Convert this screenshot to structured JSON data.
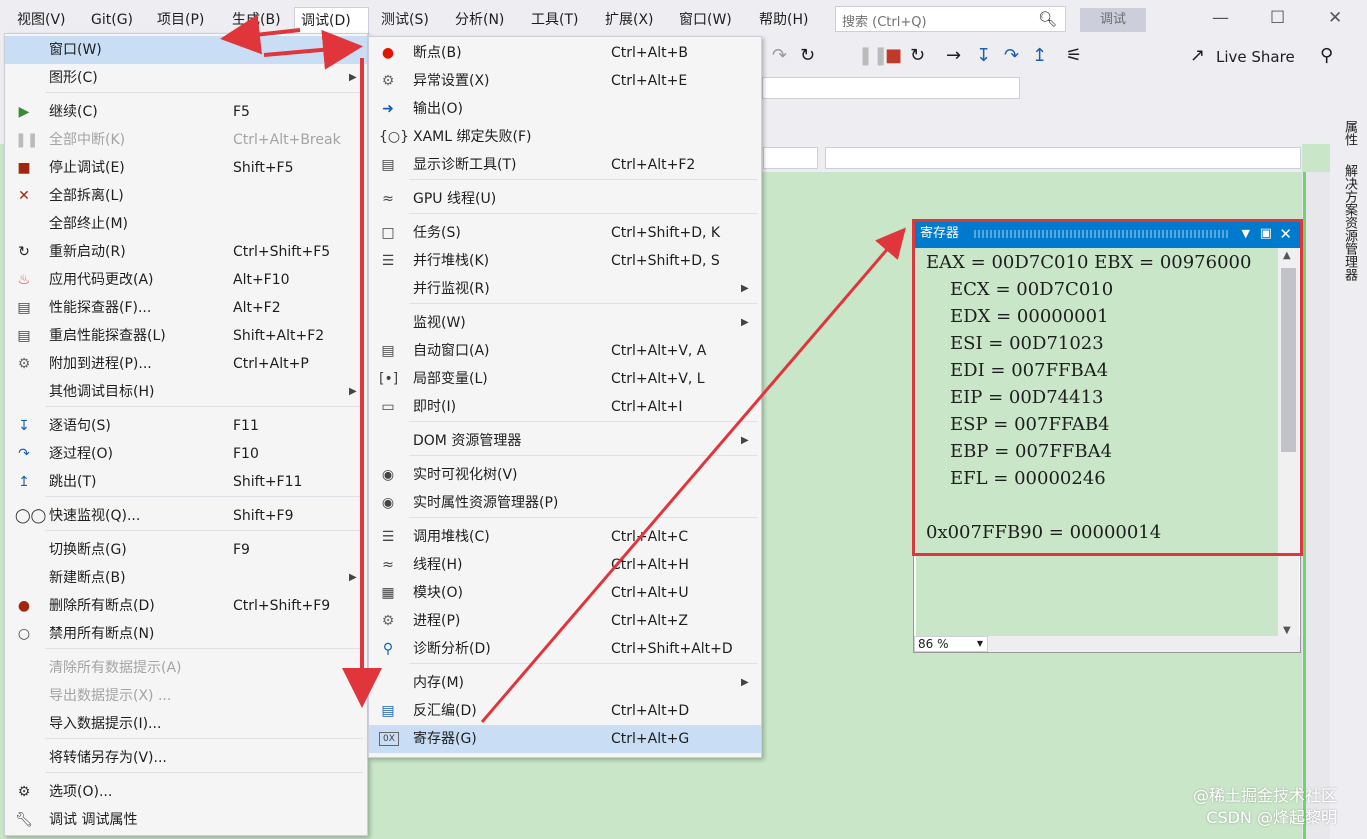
{
  "menubar": {
    "items": [
      "视图(V)",
      "Git(G)",
      "项目(P)",
      "生成(B)",
      "调试(D)",
      "测试(S)",
      "分析(N)",
      "工具(T)",
      "扩展(X)",
      "窗口(W)",
      "帮助(H)"
    ],
    "search_placeholder": "搜索 (Ctrl+Q)",
    "debug_badge": "调试"
  },
  "toolbar": {
    "live_share": "Live Share"
  },
  "side_tabs": [
    "属性",
    "解决方案资源管理器"
  ],
  "debug_menu": [
    {
      "label": "窗口(W)",
      "shortcut": "",
      "icon": "",
      "submenu": true,
      "highlighted": true
    },
    {
      "label": "图形(C)",
      "shortcut": "",
      "icon": "",
      "submenu": true
    },
    {
      "label": "继续(C)",
      "shortcut": "F5",
      "icon": "play-icon"
    },
    {
      "label": "全部中断(K)",
      "shortcut": "Ctrl+Alt+Break",
      "icon": "pause-icon",
      "disabled": true
    },
    {
      "label": "停止调试(E)",
      "shortcut": "Shift+F5",
      "icon": "stop-icon"
    },
    {
      "label": "全部拆离(L)",
      "shortcut": "",
      "icon": "close-icon"
    },
    {
      "label": "全部终止(M)",
      "shortcut": "",
      "icon": ""
    },
    {
      "label": "重新启动(R)",
      "shortcut": "Ctrl+Shift+F5",
      "icon": "restart-icon"
    },
    {
      "label": "应用代码更改(A)",
      "shortcut": "Alt+F10",
      "icon": "flame-icon"
    },
    {
      "label": "性能探查器(F)...",
      "shortcut": "Alt+F2",
      "icon": "chart-icon"
    },
    {
      "label": "重启性能探查器(L)",
      "shortcut": "Shift+Alt+F2",
      "icon": "chart-icon"
    },
    {
      "label": "附加到进程(P)...",
      "shortcut": "Ctrl+Alt+P",
      "icon": "gears-icon"
    },
    {
      "label": "其他调试目标(H)",
      "shortcut": "",
      "icon": "",
      "submenu": true
    },
    {
      "label": "逐语句(S)",
      "shortcut": "F11",
      "icon": "step-into-icon"
    },
    {
      "label": "逐过程(O)",
      "shortcut": "F10",
      "icon": "step-over-icon"
    },
    {
      "label": "跳出(T)",
      "shortcut": "Shift+F11",
      "icon": "step-out-icon"
    },
    {
      "label": "快速监视(Q)...",
      "shortcut": "Shift+F9",
      "icon": "glasses-icon"
    },
    {
      "label": "切换断点(G)",
      "shortcut": "F9",
      "icon": ""
    },
    {
      "label": "新建断点(B)",
      "shortcut": "",
      "icon": "",
      "submenu": true
    },
    {
      "label": "删除所有断点(D)",
      "shortcut": "Ctrl+Shift+F9",
      "icon": "breakpoints-delete-icon"
    },
    {
      "label": "禁用所有断点(N)",
      "shortcut": "",
      "icon": "breakpoints-disable-icon"
    },
    {
      "label": "清除所有数据提示(A)",
      "shortcut": "",
      "icon": "",
      "disabled": true
    },
    {
      "label": "导出数据提示(X) ...",
      "shortcut": "",
      "icon": "",
      "disabled": true
    },
    {
      "label": "导入数据提示(I)...",
      "shortcut": "",
      "icon": ""
    },
    {
      "label": "将转储另存为(V)...",
      "shortcut": "",
      "icon": ""
    },
    {
      "label": "选项(O)...",
      "shortcut": "",
      "icon": "gear-icon"
    },
    {
      "label": "调试 调试属性",
      "shortcut": "",
      "icon": "wrench-icon"
    }
  ],
  "window_menu": [
    {
      "label": "断点(B)",
      "shortcut": "Ctrl+Alt+B",
      "icon": "breakpoint-icon"
    },
    {
      "label": "异常设置(X)",
      "shortcut": "Ctrl+Alt+E",
      "icon": "exception-icon"
    },
    {
      "label": "输出(O)",
      "shortcut": "",
      "icon": "output-icon"
    },
    {
      "label": "XAML 绑定失败(F)",
      "shortcut": "",
      "icon": "xaml-icon"
    },
    {
      "label": "显示诊断工具(T)",
      "shortcut": "Ctrl+Alt+F2",
      "icon": "diagnostics-icon"
    },
    {
      "label": "GPU 线程(U)",
      "shortcut": "",
      "icon": "gpu-thread-icon"
    },
    {
      "label": "任务(S)",
      "shortcut": "Ctrl+Shift+D, K",
      "icon": "task-icon"
    },
    {
      "label": "并行堆栈(K)",
      "shortcut": "Ctrl+Shift+D, S",
      "icon": "parallel-stack-icon"
    },
    {
      "label": "并行监视(R)",
      "shortcut": "",
      "icon": "",
      "submenu": true
    },
    {
      "label": "监视(W)",
      "shortcut": "",
      "icon": "",
      "submenu": true
    },
    {
      "label": "自动窗口(A)",
      "shortcut": "Ctrl+Alt+V, A",
      "icon": "autos-icon"
    },
    {
      "label": "局部变量(L)",
      "shortcut": "Ctrl+Alt+V, L",
      "icon": "locals-icon"
    },
    {
      "label": "即时(I)",
      "shortcut": "Ctrl+Alt+I",
      "icon": "immediate-icon"
    },
    {
      "label": "DOM 资源管理器",
      "shortcut": "",
      "icon": "",
      "submenu": true
    },
    {
      "label": "实时可视化树(V)",
      "shortcut": "",
      "icon": "camera-icon"
    },
    {
      "label": "实时属性资源管理器(P)",
      "shortcut": "",
      "icon": "camera-icon"
    },
    {
      "label": "调用堆栈(C)",
      "shortcut": "Ctrl+Alt+C",
      "icon": "call-stack-icon"
    },
    {
      "label": "线程(H)",
      "shortcut": "Ctrl+Alt+H",
      "icon": "threads-icon"
    },
    {
      "label": "模块(O)",
      "shortcut": "Ctrl+Alt+U",
      "icon": "modules-icon"
    },
    {
      "label": "进程(P)",
      "shortcut": "Ctrl+Alt+Z",
      "icon": "processes-icon"
    },
    {
      "label": "诊断分析(D)",
      "shortcut": "Ctrl+Shift+Alt+D",
      "icon": "diagnostic-analysis-icon"
    },
    {
      "label": "内存(M)",
      "shortcut": "",
      "icon": "",
      "submenu": true
    },
    {
      "label": "反汇编(D)",
      "shortcut": "Ctrl+Alt+D",
      "icon": "disassembly-icon"
    },
    {
      "label": "寄存器(G)",
      "shortcut": "Ctrl+Alt+G",
      "icon": "registers-icon",
      "highlighted": true
    }
  ],
  "registers": {
    "title": "寄存器",
    "lines": [
      "EAX = 00D7C010 EBX = 00976000",
      "ECX = 00D7C010",
      "EDX = 00000001",
      "ESI = 00D71023",
      "EDI = 007FFBA4",
      "EIP = 00D74413",
      "ESP = 007FFAB4",
      "EBP = 007FFBA4",
      "EFL = 00000246",
      "",
      "0x007FFB90 = 00000014"
    ],
    "zoom": "86 %"
  },
  "watermark": [
    "@稀土掘金技术社区",
    "CSDN @烽起黎明"
  ],
  "colors": {
    "accent": "#007acc",
    "highlight": "#c9def5",
    "annotation": "#e0363b",
    "editor_bg": "#c9e6c9"
  }
}
